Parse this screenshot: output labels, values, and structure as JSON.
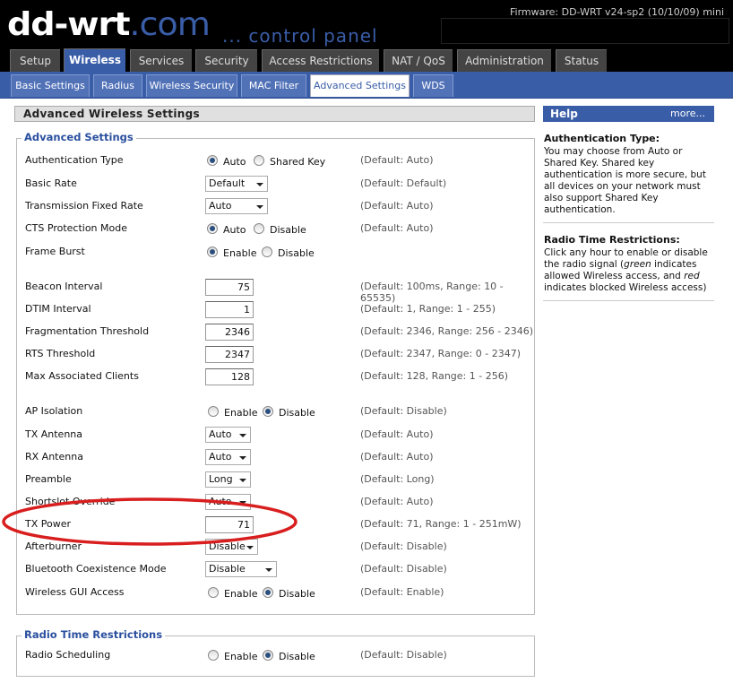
{
  "header": {
    "logo_main": "dd-wrt",
    "logo_com": ".com",
    "subtitle": "... control panel",
    "firmware": "Firmware: DD-WRT v24-sp2 (10/10/09) mini"
  },
  "main_tabs": [
    {
      "label": "Setup"
    },
    {
      "label": "Wireless"
    },
    {
      "label": "Services"
    },
    {
      "label": "Security"
    },
    {
      "label": "Access Restrictions"
    },
    {
      "label": "NAT / QoS"
    },
    {
      "label": "Administration"
    },
    {
      "label": "Status"
    }
  ],
  "sub_tabs": [
    {
      "label": "Basic Settings"
    },
    {
      "label": "Radius"
    },
    {
      "label": "Wireless Security"
    },
    {
      "label": "MAC Filter"
    },
    {
      "label": "Advanced Settings"
    },
    {
      "label": "WDS"
    }
  ],
  "page_title": "Advanced Wireless Settings",
  "advanced": {
    "legend": "Advanced Settings",
    "rows": [
      {
        "label": "Authentication Type",
        "opt1": "Auto",
        "opt2": "Shared Key",
        "def": "(Default: Auto)"
      },
      {
        "label": "Basic Rate",
        "value": "Default",
        "def": "(Default: Default)"
      },
      {
        "label": "Transmission Fixed Rate",
        "value": "Auto",
        "def": "(Default: Auto)"
      },
      {
        "label": "CTS Protection Mode",
        "opt1": "Auto",
        "opt2": "Disable",
        "def": "(Default: Auto)"
      },
      {
        "label": "Frame Burst",
        "opt1": "Enable",
        "opt2": "Disable",
        "def": ""
      },
      {
        "label": "Beacon Interval",
        "value": "75",
        "def": "(Default: 100ms, Range: 10 - 65535)"
      },
      {
        "label": "DTIM Interval",
        "value": "1",
        "def": "(Default: 1, Range: 1 - 255)"
      },
      {
        "label": "Fragmentation Threshold",
        "value": "2346",
        "def": "(Default: 2346, Range: 256 - 2346)"
      },
      {
        "label": "RTS Threshold",
        "value": "2347",
        "def": "(Default: 2347, Range: 0 - 2347)"
      },
      {
        "label": "Max Associated Clients",
        "value": "128",
        "def": "(Default: 128, Range: 1 - 256)"
      },
      {
        "label": "AP Isolation",
        "opt1": "Enable",
        "opt2": "Disable",
        "def": "(Default: Disable)"
      },
      {
        "label": "TX Antenna",
        "value": "Auto",
        "def": "(Default: Auto)"
      },
      {
        "label": "RX Antenna",
        "value": "Auto",
        "def": "(Default: Auto)"
      },
      {
        "label": "Preamble",
        "value": "Long",
        "def": "(Default: Long)"
      },
      {
        "label": "Shortslot Override",
        "value": "Auto",
        "def": "(Default: Auto)"
      },
      {
        "label": "TX Power",
        "value": "71",
        "def": "(Default: 71, Range: 1 - 251mW)"
      },
      {
        "label": "Afterburner",
        "value": "Disable",
        "def": "(Default: Disable)"
      },
      {
        "label": "Bluetooth Coexistence Mode",
        "value": "Disable",
        "def": "(Default: Disable)"
      },
      {
        "label": "Wireless GUI Access",
        "opt1": "Enable",
        "opt2": "Disable",
        "def": "(Default: Enable)"
      }
    ]
  },
  "radio_time": {
    "legend": "Radio Time Restrictions",
    "label": "Radio Scheduling",
    "opt1": "Enable",
    "opt2": "Disable",
    "def": "(Default: Disable)"
  },
  "help": {
    "title": "Help",
    "more": "more...",
    "h1": "Authentication Type:",
    "p1": "You may choose from Auto or Shared Key. Shared key authentication is more secure, but all devices on your network must also support Shared Key authentication.",
    "h2": "Radio Time Restrictions:",
    "p2a": "Click any hour to enable or disable the radio signal (",
    "p2g": "green",
    "p2b": " indicates allowed Wireless access, and ",
    "p2r": "red",
    "p2c": " indicates blocked Wireless access)"
  },
  "colors": {
    "accent": "#3a5da8",
    "annotation": "#d81e1e"
  }
}
